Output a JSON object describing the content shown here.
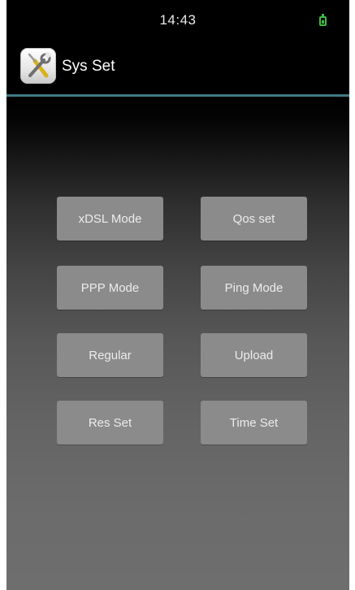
{
  "status_bar": {
    "time": "14:43",
    "battery_icon": "battery-icon"
  },
  "header": {
    "app_icon": "tools-icon",
    "title": "Sys Set",
    "divider_color": "#3f7b84"
  },
  "menu": {
    "buttons": [
      {
        "label": "xDSL Mode"
      },
      {
        "label": "Qos set"
      },
      {
        "label": "PPP Mode"
      },
      {
        "label": "Ping Mode"
      },
      {
        "label": "Regular"
      },
      {
        "label": "Upload"
      },
      {
        "label": "Res Set"
      },
      {
        "label": "Time Set"
      }
    ]
  },
  "colors": {
    "button_bg": "#8b8b8b",
    "button_text": "#ececec",
    "battery": "#3fbf3f"
  }
}
